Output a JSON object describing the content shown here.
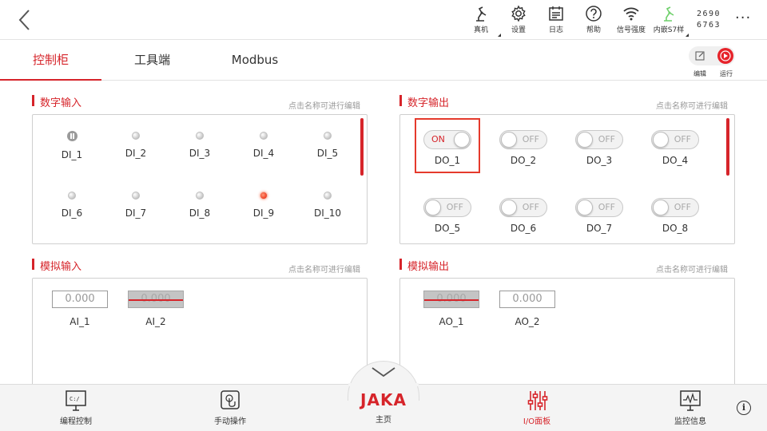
{
  "topbar": {
    "items": [
      {
        "label": "真机",
        "icon": "robot-arm-icon"
      },
      {
        "label": "设置",
        "icon": "gear-icon"
      },
      {
        "label": "日志",
        "icon": "log-icon"
      },
      {
        "label": "帮助",
        "icon": "help-icon"
      },
      {
        "label": "信号强度",
        "icon": "wifi-icon"
      },
      {
        "label": "内嵌S7样",
        "icon": "robot-arm-green-icon"
      }
    ],
    "coords_line1": "2690",
    "coords_line2": "6763",
    "more": "···"
  },
  "tabs": [
    {
      "label": "控制柜",
      "active": true
    },
    {
      "label": "工具端",
      "active": false
    },
    {
      "label": "Modbus",
      "active": false
    }
  ],
  "actions": {
    "edit_label": "编辑",
    "run_label": "运行"
  },
  "digital_input": {
    "title": "数字输入",
    "hint": "点击名称可进行编辑",
    "items": [
      {
        "name": "DI_1",
        "state": "pause"
      },
      {
        "name": "DI_2",
        "state": "off"
      },
      {
        "name": "DI_3",
        "state": "off"
      },
      {
        "name": "DI_4",
        "state": "off"
      },
      {
        "name": "DI_5",
        "state": "off"
      },
      {
        "name": "DI_6",
        "state": "off"
      },
      {
        "name": "DI_7",
        "state": "off"
      },
      {
        "name": "DI_8",
        "state": "off"
      },
      {
        "name": "DI_9",
        "state": "on"
      },
      {
        "name": "DI_10",
        "state": "off"
      }
    ]
  },
  "digital_output": {
    "title": "数字输出",
    "hint": "点击名称可进行编辑",
    "on_text": "ON",
    "off_text": "OFF",
    "items": [
      {
        "name": "DO_1",
        "state": "on"
      },
      {
        "name": "DO_2",
        "state": "off"
      },
      {
        "name": "DO_3",
        "state": "off"
      },
      {
        "name": "DO_4",
        "state": "off"
      },
      {
        "name": "DO_5",
        "state": "off"
      },
      {
        "name": "DO_6",
        "state": "off"
      },
      {
        "name": "DO_7",
        "state": "off"
      },
      {
        "name": "DO_8",
        "state": "off"
      }
    ]
  },
  "analog_input": {
    "title": "模拟输入",
    "hint": "点击名称可进行编辑",
    "items": [
      {
        "name": "AI_1",
        "value": "0.000",
        "disabled": false
      },
      {
        "name": "AI_2",
        "value": "0.000",
        "disabled": true
      }
    ]
  },
  "analog_output": {
    "title": "模拟输出",
    "hint": "点击名称可进行编辑",
    "items": [
      {
        "name": "AO_1",
        "value": "0.000",
        "disabled": true
      },
      {
        "name": "AO_2",
        "value": "0.000",
        "disabled": false
      }
    ]
  },
  "bottom_nav": {
    "items": [
      {
        "label": "编程控制",
        "icon": "program-console-icon"
      },
      {
        "label": "手动操作",
        "icon": "manual-touch-icon"
      },
      {
        "label": "主页",
        "icon": "jaka-logo",
        "logo_text": "JAKA"
      },
      {
        "label": "I/O面板",
        "icon": "io-sliders-icon",
        "active": true
      },
      {
        "label": "监控信息",
        "icon": "monitor-icon"
      }
    ],
    "info": "i"
  },
  "colors": {
    "accent": "#d6242a",
    "led_on": "#f2462c",
    "border": "#cfcfcf"
  }
}
